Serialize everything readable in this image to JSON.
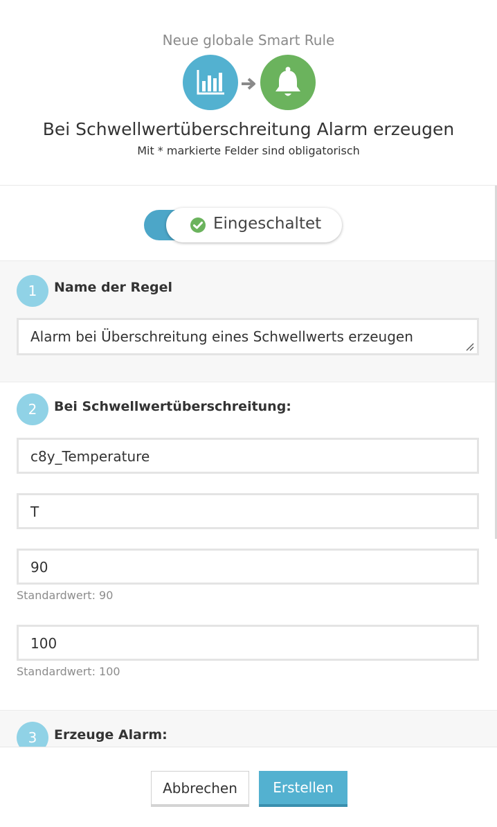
{
  "header": {
    "subtitle": "Neue globale Smart Rule",
    "title": "Bei Schwellwertüberschreitung Alarm erzeugen",
    "required_note": "Mit * markierte Felder sind obligatorisch",
    "icons": [
      "bar-chart-icon",
      "arrow-right-icon",
      "bell-icon"
    ],
    "colors": {
      "chart_circle": "#53b1d0",
      "bell_circle": "#6bb35d"
    }
  },
  "toggle": {
    "label": "Eingeschaltet",
    "state": "on",
    "colors": {
      "track": "#4ca6c8",
      "check": "#6bb35d"
    }
  },
  "sections": {
    "name": {
      "step": "1",
      "title": "Name der Regel",
      "value": "Alarm bei Überschreitung eines Schwellwerts erzeugen"
    },
    "threshold": {
      "step": "2",
      "title": "Bei Schwellwertüberschreitung:",
      "fragment_value": "c8y_Temperature",
      "series_value": "T",
      "min_value": "90",
      "min_help": "Standardwert: 90",
      "max_value": "100",
      "max_help": "Standardwert: 100"
    },
    "alarm": {
      "step": "3",
      "title": "Erzeuge Alarm:"
    }
  },
  "footer": {
    "cancel_label": "Abbrechen",
    "create_label": "Erstellen",
    "colors": {
      "create_bg": "#53b1d0"
    }
  }
}
